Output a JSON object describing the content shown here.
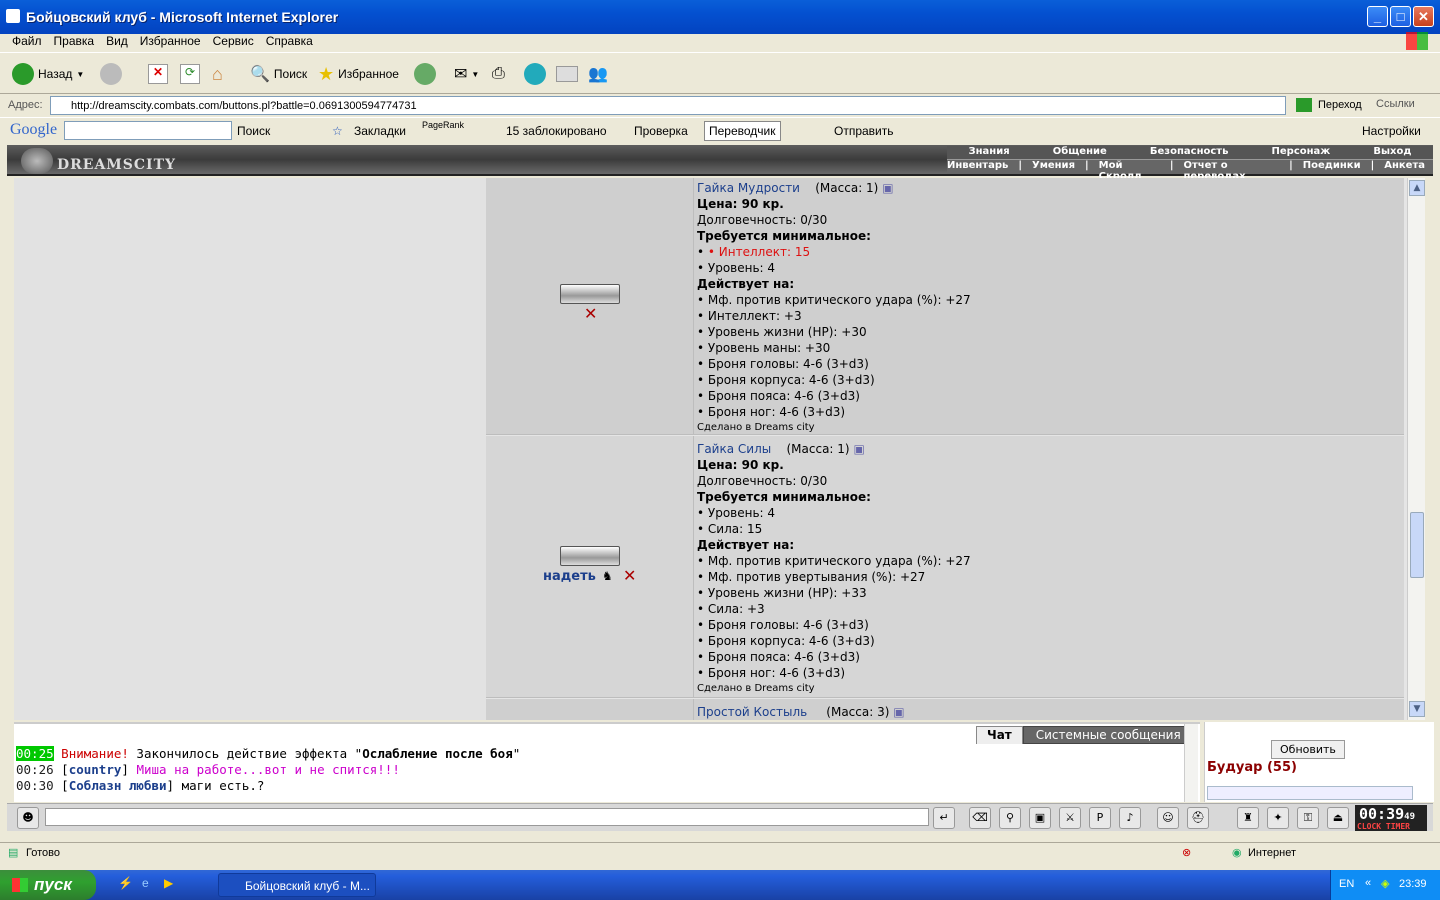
{
  "window": {
    "title": "Бойцовский клуб - Microsoft Internet Explorer"
  },
  "menu": [
    "Файл",
    "Правка",
    "Вид",
    "Избранное",
    "Сервис",
    "Справка"
  ],
  "toolbar": {
    "back": "Назад",
    "search": "Поиск",
    "favorites": "Избранное"
  },
  "address": {
    "label": "Адрес:",
    "url": "http://dreamscity.combats.com/buttons.pl?battle=0.0691300594774731",
    "go": "Переход",
    "links": "Ссылки"
  },
  "googlebar": {
    "search": "Поиск",
    "bookmarks": "Закладки",
    "pagerank": "PageRank",
    "blocked": "15 заблокировано",
    "check": "Проверка",
    "translator": "Переводчик",
    "send": "Отправить",
    "settings": "Настройки"
  },
  "game": {
    "logo": "DREAMSCITY",
    "nav_top": [
      "Знания",
      "Общение",
      "Безопасность",
      "Персонаж",
      "Выход"
    ],
    "nav_bottom": [
      "Инвентарь",
      "Умения",
      "Мой Скролл",
      "Отчет о переводах",
      "Поединки",
      "Анкета"
    ]
  },
  "items": [
    {
      "name": "Гайка Мудрости",
      "mass": "(Масса: 1)",
      "price": "Цена: 90 кр.",
      "durability": "Долговечность: 0/30",
      "req_title": "Требуется минимальное:",
      "reqs": [
        "• Интеллект: 15",
        "• Уровень: 4"
      ],
      "acts_title": "Действует на:",
      "acts": [
        "• Мф. против критического удара (%): +27",
        "• Интеллект: +3",
        "• Уровень жизни (HP): +30",
        "• Уровень маны: +30",
        "• Броня головы: 4-6 (3+d3)",
        "• Броня корпуса: 4-6 (3+d3)",
        "• Броня пояса: 4-6 (3+d3)",
        "• Броня ног: 4-6 (3+d3)"
      ],
      "made": "Сделано в Dreams city"
    },
    {
      "name": "Гайка Силы",
      "mass": "(Масса: 1)",
      "price": "Цена: 90 кр.",
      "durability": "Долговечность: 0/30",
      "req_title": "Требуется минимальное:",
      "reqs": [
        "• Уровень: 4",
        "• Сила: 15"
      ],
      "acts_title": "Действует на:",
      "acts": [
        "• Мф. против критического удара (%): +27",
        "• Мф. против увертывания (%): +27",
        "• Уровень жизни (HP): +33",
        "• Сила: +3",
        "• Броня головы: 4-6 (3+d3)",
        "• Броня корпуса: 4-6 (3+d3)",
        "• Броня пояса: 4-6 (3+d3)",
        "• Броня ног: 4-6 (3+d3)"
      ],
      "made": "Сделано в Dreams city",
      "wear": "надеть"
    },
    {
      "name": "Простой Костыль",
      "mass": "(Масса: 3)"
    }
  ],
  "chat": {
    "tabs": [
      "Чат",
      "Системные сообщения"
    ],
    "lines": [
      {
        "time": "00:25",
        "prefix": "Внимание!",
        "text": " Закончилось действие эффекта \"",
        "bold": "Ослабление после боя",
        "suffix": "\""
      },
      {
        "time": "00:26",
        "user": "country",
        "text": "Миша на работе...вот и не спится!!!"
      },
      {
        "time": "00:30",
        "user": "Соблазн любви",
        "text": "маги есть.?"
      }
    ]
  },
  "room": {
    "refresh": "Обновить",
    "name": "Будуар (55)"
  },
  "clock": {
    "time": "00:39",
    "sec": "49",
    "label": "CLOCK TIMER"
  },
  "status": {
    "text": "Готово",
    "zone": "Интернет"
  },
  "taskbar": {
    "start": "пуск",
    "task": "Бойцовский клуб - М...",
    "lang": "EN",
    "time": "23:39"
  },
  "colors": {
    "accent": "#1c3f8c",
    "warning": "#d11111",
    "title_bar": "#0450D0"
  }
}
